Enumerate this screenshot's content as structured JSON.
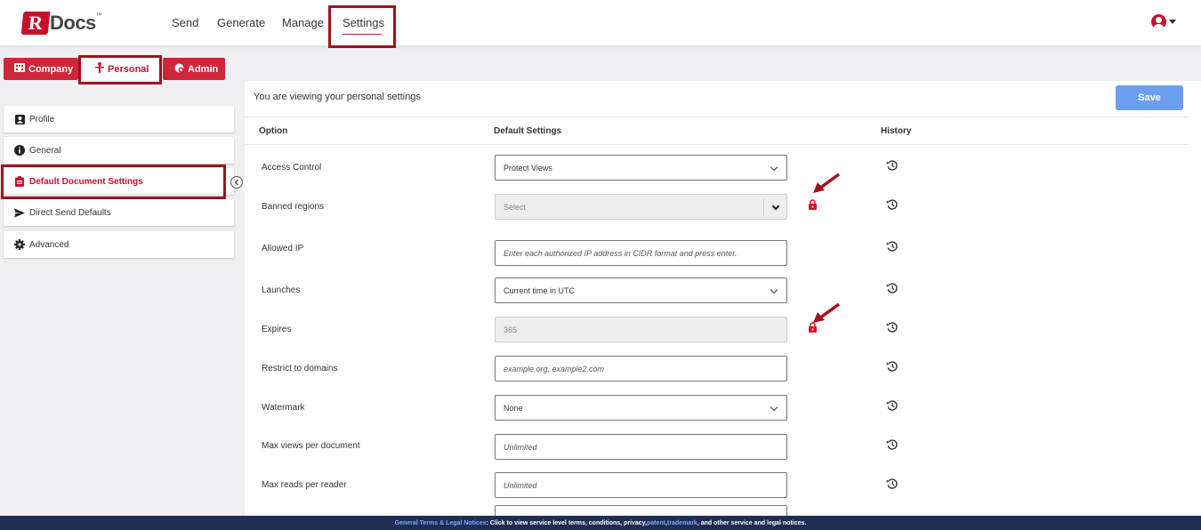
{
  "app": {
    "logo_letter": "R",
    "logo_text": "Docs",
    "logo_tm": "™"
  },
  "nav": {
    "items": [
      "Send",
      "Generate",
      "Manage",
      "Settings"
    ],
    "active": "Settings"
  },
  "tabs": [
    {
      "label": "Company",
      "icon": "building-icon"
    },
    {
      "label": "Personal",
      "icon": "person-icon"
    },
    {
      "label": "Admin",
      "icon": "shield-icon"
    }
  ],
  "sidebar": {
    "items": [
      {
        "label": "Profile",
        "icon": "profile-icon"
      },
      {
        "label": "General",
        "icon": "info-icon"
      },
      {
        "label": "Default Document Settings",
        "icon": "clipboard-icon",
        "active": true
      },
      {
        "label": "Direct Send Defaults",
        "icon": "paper-plane-icon"
      },
      {
        "label": "Advanced",
        "icon": "gear-icon"
      }
    ]
  },
  "main": {
    "viewing_text": "You are viewing your personal settings",
    "save_label": "Save",
    "headers": {
      "option": "Option",
      "default": "Default Settings",
      "history": "History"
    },
    "rows": [
      {
        "label": "Access Control",
        "value": "Protect Views",
        "kind": "select"
      },
      {
        "label": "Banned regions",
        "value": "Select",
        "kind": "select-disabled",
        "locked": true
      },
      {
        "label": "Allowed IP",
        "placeholder": "Enter each authorized IP address in CIDR format and press enter.",
        "kind": "input"
      },
      {
        "label": "Launches",
        "value": "Current time in UTC",
        "kind": "select"
      },
      {
        "label": "Expires",
        "value": "365",
        "kind": "input-disabled",
        "locked": true
      },
      {
        "label": "Restrict to domains",
        "placeholder": "example.org, example2.com",
        "kind": "input"
      },
      {
        "label": "Watermark",
        "value": "None",
        "kind": "select"
      },
      {
        "label": "Max views per document",
        "placeholder": "Unlimited",
        "kind": "input"
      },
      {
        "label": "Max reads per reader",
        "placeholder": "Unlimited",
        "kind": "input"
      }
    ]
  },
  "footer": {
    "lead": "General Terms & Legal Notices",
    "text1": ": Click to view service level terms, conditions, privacy, ",
    "patent": "patent",
    "comma": ", ",
    "trademark": "trademark",
    "text2": ", and other service and legal notices."
  },
  "colors": {
    "brand": "#c8102e",
    "save": "#6b9eec",
    "footer": "#1e2d52",
    "highlight": "#a10f1f"
  }
}
